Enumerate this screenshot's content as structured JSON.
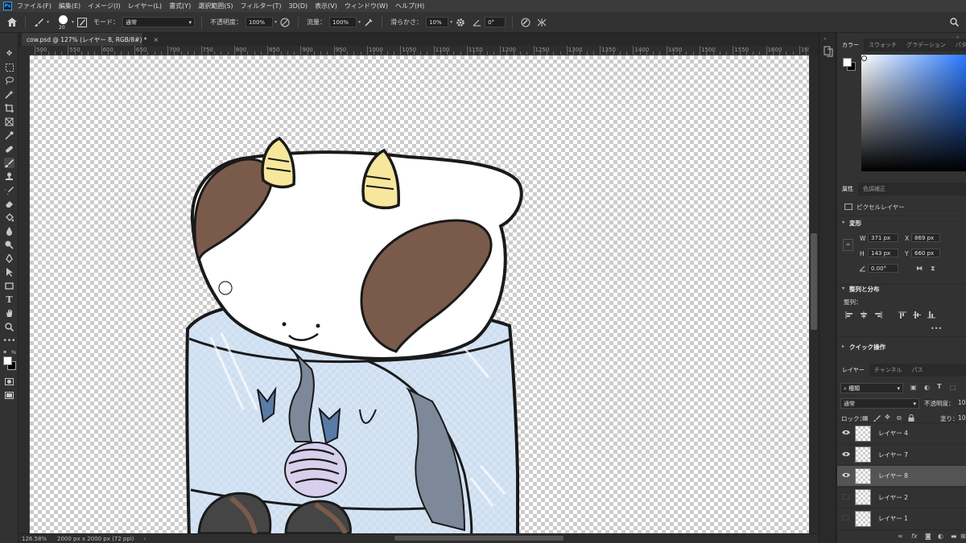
{
  "menu": {
    "logo": "Ps",
    "items": [
      "ファイル(F)",
      "編集(E)",
      "イメージ(I)",
      "レイヤー(L)",
      "書式(Y)",
      "選択範囲(S)",
      "フィルター(T)",
      "3D(D)",
      "表示(V)",
      "ウィンドウ(W)",
      "ヘルプ(H)"
    ]
  },
  "options": {
    "brush_size": "20",
    "mode_label": "モード：",
    "mode_value": "通常",
    "opacity_label": "不透明度：",
    "opacity_value": "100%",
    "flow_label": "流量：",
    "flow_value": "100%",
    "smoothing_label": "滑らかさ：",
    "smoothing_value": "10%",
    "angle_value": "0°"
  },
  "document": {
    "tab_title": "cow.psd @ 127% (レイヤー 8, RGB/8#) *",
    "close_glyph": "×"
  },
  "rulers": {
    "h_labels": [
      "500",
      "550",
      "600",
      "650",
      "700",
      "750",
      "800",
      "850",
      "900",
      "950",
      "1000",
      "1050",
      "1100",
      "1150",
      "1200",
      "1250",
      "1300",
      "1350",
      "1400",
      "1450",
      "1500",
      "1550",
      "1600",
      "1650"
    ]
  },
  "status": {
    "zoom": "126.58%",
    "doc_info": "2000 px x 2000 px (72 ppi)"
  },
  "color_panel": {
    "tabs": [
      "カラー",
      "スウォッチ",
      "グラデーション",
      "パターン"
    ],
    "accent": "#2a79ff"
  },
  "properties": {
    "tabs": [
      "属性",
      "色調補正"
    ],
    "kind": "ピクセルレイヤー",
    "transform_header": "変形",
    "w_label": "W",
    "w_value": "371 px",
    "h_label": "H",
    "h_value": "143 px",
    "x_label": "X",
    "x_value": "869 px",
    "y_label": "Y",
    "y_value": "660 px",
    "angle_value": "0.00°",
    "align_header": "整列と分布",
    "align_label": "整列：",
    "quick_header": "クイック操作"
  },
  "layers_panel": {
    "tabs": [
      "レイヤー",
      "チャンネル",
      "パス"
    ],
    "filter_label": "種類",
    "blend_mode": "通常",
    "opacity_label": "不透明度：",
    "opacity_value": "100",
    "lock_label": "ロック：",
    "fill_label": "塗り：",
    "fill_value": "100",
    "layers": [
      {
        "name": "レイヤー 4",
        "visible": true,
        "active": false
      },
      {
        "name": "レイヤー 7",
        "visible": true,
        "active": false
      },
      {
        "name": "レイヤー 8",
        "visible": true,
        "active": true
      },
      {
        "name": "レイヤー 2",
        "visible": false,
        "active": false
      },
      {
        "name": "レイヤー 1",
        "visible": false,
        "active": false
      }
    ]
  }
}
